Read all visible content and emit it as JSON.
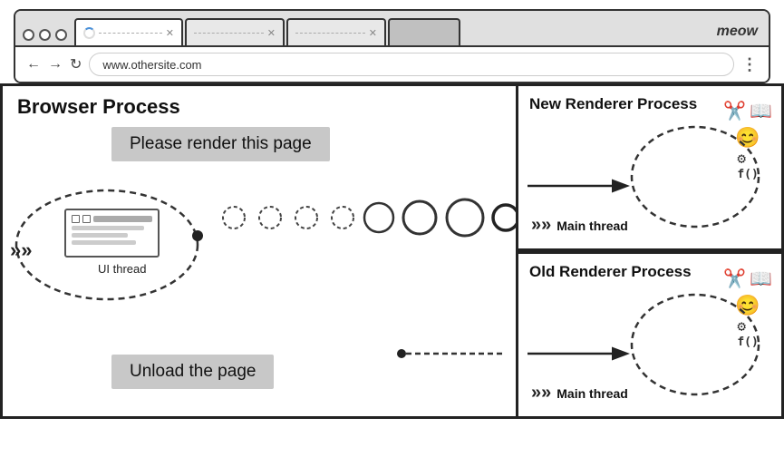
{
  "browser_chrome": {
    "tab1": {
      "loading": true,
      "text": ""
    },
    "tab2": {
      "text": "· · · · · · ·"
    },
    "tab3": {
      "text": "· · · · · · ·"
    },
    "meow_tab": "meow",
    "address": "www.othersite.com",
    "nav": {
      "back": "←",
      "forward": "→",
      "refresh": "↻",
      "menu": "⋮"
    }
  },
  "diagram": {
    "browser_process_title": "Browser Process",
    "new_renderer_title": "New Renderer Process",
    "old_renderer_title": "Old Renderer Process",
    "message1": "Please render this page",
    "message2": "Unload the page",
    "ui_thread_label": "UI thread",
    "main_thread_label": "Main thread",
    "chevrons": "»»"
  }
}
